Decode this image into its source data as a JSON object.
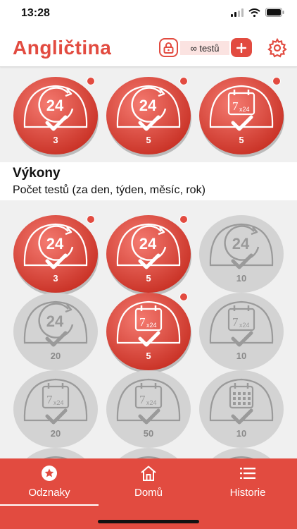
{
  "status_bar": {
    "time": "13:28"
  },
  "header": {
    "title": "Angličtina",
    "tests_label": "∞ testů"
  },
  "colors": {
    "accent": "#e24b40",
    "inactive": "#d3d3d3",
    "background": "#f0f0f0"
  },
  "featured_badges": [
    {
      "icon": "24h-check-icon",
      "count": "3",
      "active": true
    },
    {
      "icon": "24h-check-icon",
      "count": "5",
      "active": true
    },
    {
      "icon": "calendar-7x24-icon",
      "count": "5",
      "active": true
    }
  ],
  "section": {
    "title": "Výkony",
    "subtitle": "Počet testů (za den, týden, měsíc, rok)"
  },
  "grid_badges": [
    {
      "icon": "24h-check-icon",
      "count": "3",
      "active": true
    },
    {
      "icon": "24h-check-icon",
      "count": "5",
      "active": true
    },
    {
      "icon": "24h-check-icon",
      "count": "10",
      "active": false
    },
    {
      "icon": "24h-check-icon",
      "count": "20",
      "active": false
    },
    {
      "icon": "calendar-7x24-icon",
      "count": "5",
      "active": true
    },
    {
      "icon": "calendar-7x24-icon",
      "count": "10",
      "active": false
    },
    {
      "icon": "calendar-7x24-icon",
      "count": "20",
      "active": false
    },
    {
      "icon": "calendar-7x24-icon",
      "count": "50",
      "active": false
    },
    {
      "icon": "calendar-month-icon",
      "count": "10",
      "active": false
    }
  ],
  "tabs": [
    {
      "label": "Odznaky",
      "icon": "star-badge-icon",
      "selected": true
    },
    {
      "label": "Domů",
      "icon": "home-icon",
      "selected": false
    },
    {
      "label": "Historie",
      "icon": "list-icon",
      "selected": false
    }
  ]
}
